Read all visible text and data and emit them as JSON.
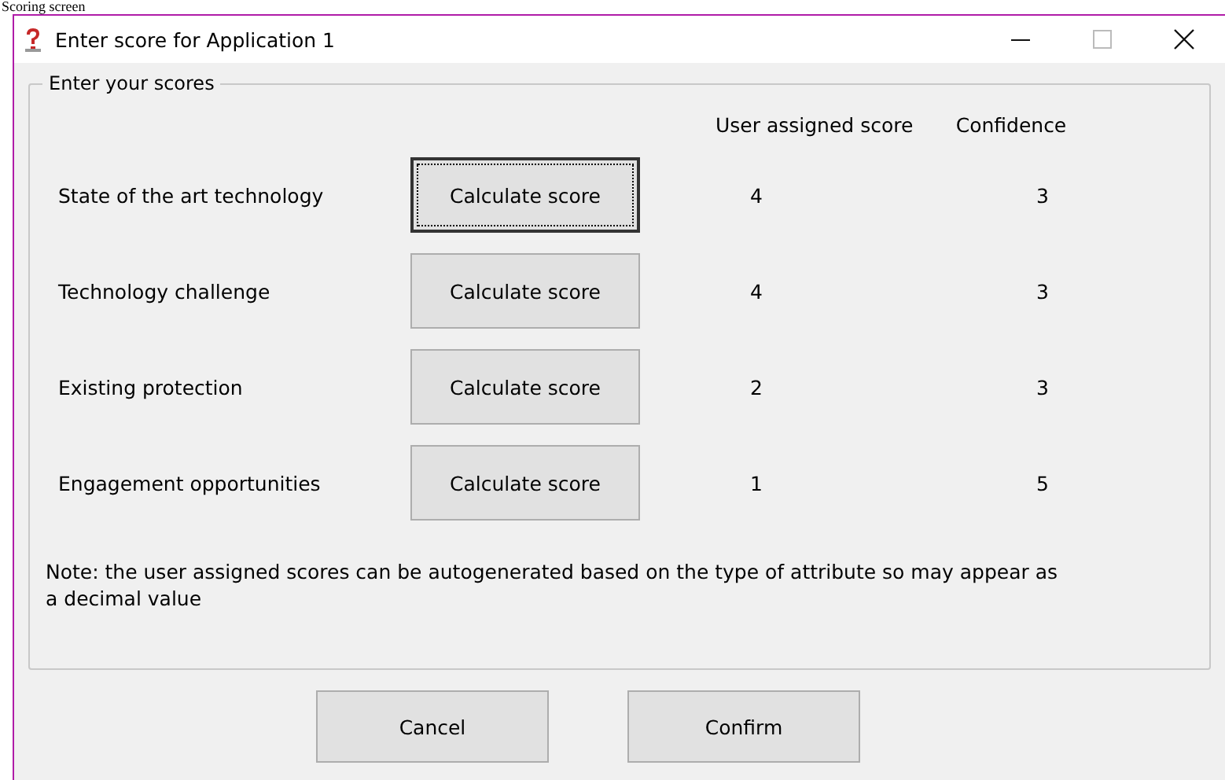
{
  "caption": "Scoring screen",
  "window": {
    "title": "Enter score for Application 1"
  },
  "group": {
    "legend": "Enter your scores"
  },
  "columns": [
    "User assigned score",
    "Confidence"
  ],
  "rows": [
    {
      "label": "State of the art technology",
      "button": "Calculate score",
      "focused": true,
      "score": "4",
      "confidence": "3"
    },
    {
      "label": "Technology challenge",
      "button": "Calculate score",
      "focused": false,
      "score": "4",
      "confidence": "3"
    },
    {
      "label": "Existing protection",
      "button": "Calculate score",
      "focused": false,
      "score": "2",
      "confidence": "3"
    },
    {
      "label": "Engagement opportunities",
      "button": "Calculate score",
      "focused": false,
      "score": "1",
      "confidence": "5"
    }
  ],
  "note": "Note: the user assigned scores can be autogenerated based on the type of attribute so may appear as a decimal value",
  "buttons": [
    "Cancel",
    "Confirm"
  ]
}
